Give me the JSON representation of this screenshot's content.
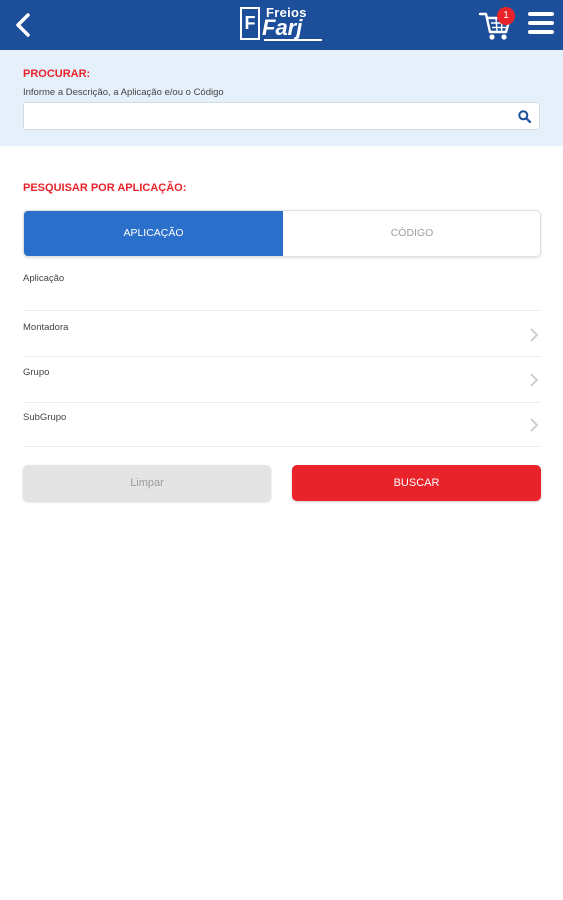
{
  "header": {
    "logo_mark": "F",
    "logo_top": "Freios",
    "logo_main": "Farj",
    "cart_count": "1"
  },
  "search": {
    "title": "PROCURAR:",
    "hint": "Informe a Descrição, a Aplicação e/ou o Código",
    "value": "",
    "placeholder": ""
  },
  "application": {
    "title": "PESQUISAR POR APLICAÇÃO:",
    "tabs": [
      {
        "label": "APLICAÇÃO",
        "active": true
      },
      {
        "label": "CÓDIGO",
        "active": false
      }
    ],
    "fields": [
      {
        "label": "Aplicação"
      },
      {
        "label": "Montadora"
      },
      {
        "label": "Grupo"
      },
      {
        "label": "SubGrupo"
      }
    ]
  },
  "actions": {
    "clear_label": "Limpar",
    "search_label": "BUSCAR"
  },
  "colors": {
    "header": "#1d4e9a",
    "accent_red": "#e8232a",
    "tab_active": "#2a6fc9",
    "panel_bg": "#e6f0fb"
  },
  "icons": [
    "back-arrow-icon",
    "cart-icon",
    "menu-icon",
    "search-icon",
    "chevron-right-icon"
  ]
}
